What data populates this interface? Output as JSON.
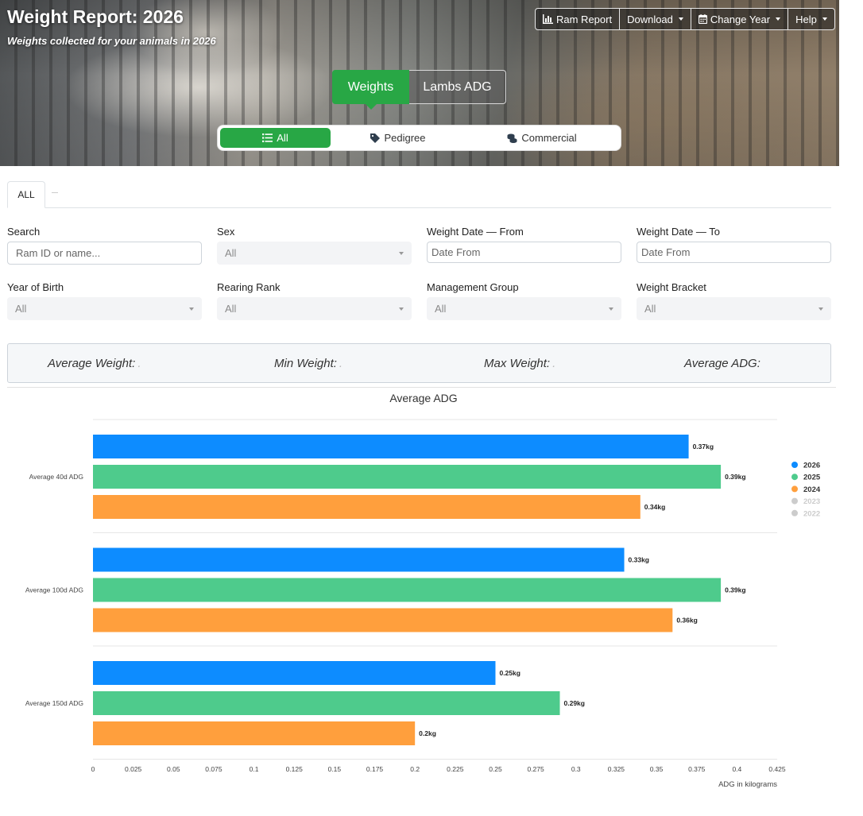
{
  "header": {
    "title": "Weight Report: 2026",
    "subtitle": "Weights collected for your animals in 2026"
  },
  "toolbar": {
    "ram_report": "Ram Report",
    "download": "Download",
    "change_year": "Change Year",
    "help": "Help"
  },
  "view_toggle": {
    "weights": "Weights",
    "lambs_adg": "Lambs ADG",
    "active": "Weights"
  },
  "segment": {
    "all": "All",
    "pedigree": "Pedigree",
    "commercial": "Commercial",
    "active": "All"
  },
  "tabs": [
    {
      "label": "ALL"
    }
  ],
  "filters": {
    "search": {
      "label": "Search",
      "placeholder": "Ram ID or name..."
    },
    "sex": {
      "label": "Sex",
      "value": "All"
    },
    "date_from": {
      "label": "Weight Date — From",
      "placeholder": "Date From"
    },
    "date_to": {
      "label": "Weight Date — To",
      "placeholder": "Date From"
    },
    "year_of_birth": {
      "label": "Year of Birth",
      "value": "All"
    },
    "rearing_rank": {
      "label": "Rearing Rank",
      "value": "All"
    },
    "management_group": {
      "label": "Management Group",
      "value": "All"
    },
    "weight_bracket": {
      "label": "Weight Bracket",
      "value": "All"
    }
  },
  "stats": {
    "average_weight": {
      "label": "Average Weight:",
      "value": "."
    },
    "min_weight": {
      "label": "Min Weight:",
      "value": "."
    },
    "max_weight": {
      "label": "Max Weight:",
      "value": "."
    },
    "average_adg": {
      "label": "Average ADG:",
      "value": ""
    }
  },
  "colors": {
    "accent_green": "#28a745",
    "series_2026": "#0d8cff",
    "series_2025": "#4ecb8c",
    "series_2024": "#ff9f3d",
    "legend_inactive": "#cccccc"
  },
  "chart_data": {
    "type": "bar",
    "orientation": "horizontal",
    "title": "Average ADG",
    "xlabel": "ADG in kilograms",
    "ylabel": "",
    "categories": [
      "Average 40d ADG",
      "Average 100d ADG",
      "Average 150d ADG"
    ],
    "series": [
      {
        "name": "2026",
        "color": "#0d8cff",
        "values": [
          0.37,
          0.33,
          0.25
        ],
        "labels": [
          "0.37kg",
          "0.33kg",
          "0.25kg"
        ],
        "visible": true
      },
      {
        "name": "2025",
        "color": "#4ecb8c",
        "values": [
          0.39,
          0.39,
          0.29
        ],
        "labels": [
          "0.39kg",
          "0.39kg",
          "0.29kg"
        ],
        "visible": true
      },
      {
        "name": "2024",
        "color": "#ff9f3d",
        "values": [
          0.34,
          0.36,
          0.2
        ],
        "labels": [
          "0.34kg",
          "0.36kg",
          "0.2kg"
        ],
        "visible": true
      },
      {
        "name": "2023",
        "color": "#cccccc",
        "values": [],
        "labels": [],
        "visible": false
      },
      {
        "name": "2022",
        "color": "#cccccc",
        "values": [],
        "labels": [],
        "visible": false
      }
    ],
    "xlim": [
      0,
      0.425
    ],
    "xticks": [
      0,
      0.025,
      0.05,
      0.075,
      0.1,
      0.125,
      0.15,
      0.175,
      0.2,
      0.225,
      0.25,
      0.275,
      0.3,
      0.325,
      0.35,
      0.375,
      0.4,
      0.425
    ],
    "xtick_labels": [
      "0",
      "0.025",
      "0.05",
      "0.075",
      "0.1",
      "0.125",
      "0.15",
      "0.175",
      "0.2",
      "0.225",
      "0.25",
      "0.275",
      "0.3",
      "0.325",
      "0.35",
      "0.375",
      "0.4",
      "0.425"
    ],
    "grid": "horizontal category separators",
    "legend": "right"
  }
}
